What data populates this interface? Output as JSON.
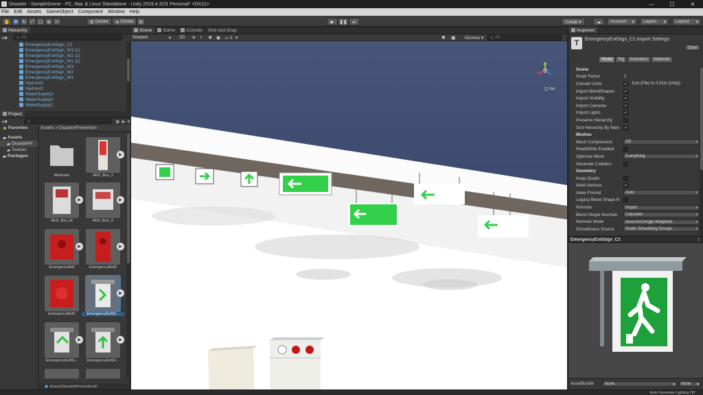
{
  "window": {
    "title": "Disaster - SampleScene - PC, Mac & Linux Standalone - Unity 2019.4.31f1 Personal* <DX11>",
    "controls": [
      "—",
      "☐",
      "✕"
    ]
  },
  "menu": [
    "File",
    "Edit",
    "Assets",
    "GameObject",
    "Component",
    "Window",
    "Help"
  ],
  "toolbar": {
    "pivot_label": "Center",
    "space_label": "Global",
    "collab_label": "Collab ▾",
    "account_label": "Account",
    "layers_label": "Layers",
    "layout_label": "Layout"
  },
  "hierarchy": {
    "tab": "Hierarchy",
    "search_placeholder": "All",
    "items": [
      "EmergencyExitSign_C1",
      "EmergencyExitSign_W3 (1)",
      "EmergencyExitSign_W2 (1)",
      "EmergencyExitSign_W1 (1)",
      "EmergencyExitSign_W3",
      "EmergencyExitSign_W2",
      "EmergencyExitSign_W1",
      "Hydrant2",
      "Hydrant1",
      "WaterSupply3",
      "WaterSupply2",
      "WaterSupply1"
    ]
  },
  "project": {
    "tab": "Project",
    "tree": [
      {
        "label": "Favorites",
        "bold": true
      },
      {
        "label": "Assets",
        "bold": true
      },
      {
        "label": "DisasterPr",
        "bold": false
      },
      {
        "label": "Scenes",
        "bold": false
      },
      {
        "label": "Packages",
        "bold": true
      }
    ],
    "breadcrumb": "Assets > DisasterPrevention",
    "assets": [
      {
        "label": "Materials",
        "kind": "folder"
      },
      {
        "label": "AED_Box_1",
        "kind": "model"
      },
      {
        "label": "AED_Box_M",
        "kind": "model"
      },
      {
        "label": "AED_Box_S",
        "kind": "model"
      },
      {
        "label": "EmergencyBell",
        "kind": "model"
      },
      {
        "label": "EmergencyBell2",
        "kind": "model"
      },
      {
        "label": "EmergencyBell1",
        "kind": "model"
      },
      {
        "label": "EmergencyExitSi...",
        "kind": "model"
      },
      {
        "label": "EmergencyExitSi...",
        "kind": "model"
      },
      {
        "label": "EmergencyExitSi...",
        "kind": "model"
      }
    ],
    "status_path": "Assets/DisasterPrevention/E"
  },
  "scene": {
    "tabs": [
      "Scene",
      "Game",
      "Console",
      "Grid and Snap"
    ],
    "shading": "Shaded",
    "mode_2d": "2D",
    "gizmo_count": "2",
    "gizmos": "Gizmos ▾",
    "search": "All",
    "iso_label": "Iso"
  },
  "inspector": {
    "tab": "Inspector",
    "title": "EmergencyExitSign_C1 Import Settings",
    "open_label": "Open",
    "tabs": [
      "Model",
      "Rig",
      "Animation",
      "Materials"
    ],
    "properties": [
      {
        "type": "header",
        "label": "Scene"
      },
      {
        "type": "text",
        "label": "Scale Factor",
        "value": "1"
      },
      {
        "type": "check",
        "label": "Convert Units",
        "value": "✓",
        "extra": "1cm (File) to 0.01m (Unity)"
      },
      {
        "type": "check",
        "label": "Import BlendShapes",
        "value": "✓"
      },
      {
        "type": "check",
        "label": "Import Visibility",
        "value": "✓"
      },
      {
        "type": "check",
        "label": "Import Cameras",
        "value": "✓"
      },
      {
        "type": "check",
        "label": "Import Lights",
        "value": "✓"
      },
      {
        "type": "check",
        "label": "Preserve Hierarchy",
        "value": ""
      },
      {
        "type": "check",
        "label": "Sort Hierarchy By Nam",
        "value": "✓"
      },
      {
        "type": "header",
        "label": "Meshes"
      },
      {
        "type": "dropdown",
        "label": "Mesh Compression",
        "value": "Off"
      },
      {
        "type": "check",
        "label": "Read/Write Enabled",
        "value": ""
      },
      {
        "type": "dropdown",
        "label": "Optimize Mesh",
        "value": "Everything"
      },
      {
        "type": "check",
        "label": "Generate Colliders",
        "value": ""
      },
      {
        "type": "header",
        "label": "Geometry"
      },
      {
        "type": "check",
        "label": "Keep Quads",
        "value": ""
      },
      {
        "type": "check",
        "label": "Weld Vertices",
        "value": "✓"
      },
      {
        "type": "dropdown",
        "label": "Index Format",
        "value": "Auto"
      },
      {
        "type": "check",
        "label": "Legacy Blend Shape N",
        "value": ""
      },
      {
        "type": "dropdown",
        "label": "Normals",
        "value": "Import"
      },
      {
        "type": "dropdown",
        "label": "Blend Shape Normals",
        "value": "Calculate"
      },
      {
        "type": "dropdown",
        "label": "Normals Mode",
        "value": "Area And Angle Weighted"
      },
      {
        "type": "dropdown",
        "label": "Smoothness Source",
        "value": "Prefer Smoothing Groups"
      }
    ],
    "preview_title": "EmergencyExitSign_C1",
    "assetbundle_label": "AssetBundle",
    "assetbundle_value": "None",
    "assetbundle_variant": "None"
  },
  "status": {
    "right": "Auto Generate Lighting Off"
  },
  "colors": {
    "sign_green": "#33d04a",
    "selection_blue": "#2c5d87",
    "hierarchy_blue": "#7fb7e6"
  }
}
